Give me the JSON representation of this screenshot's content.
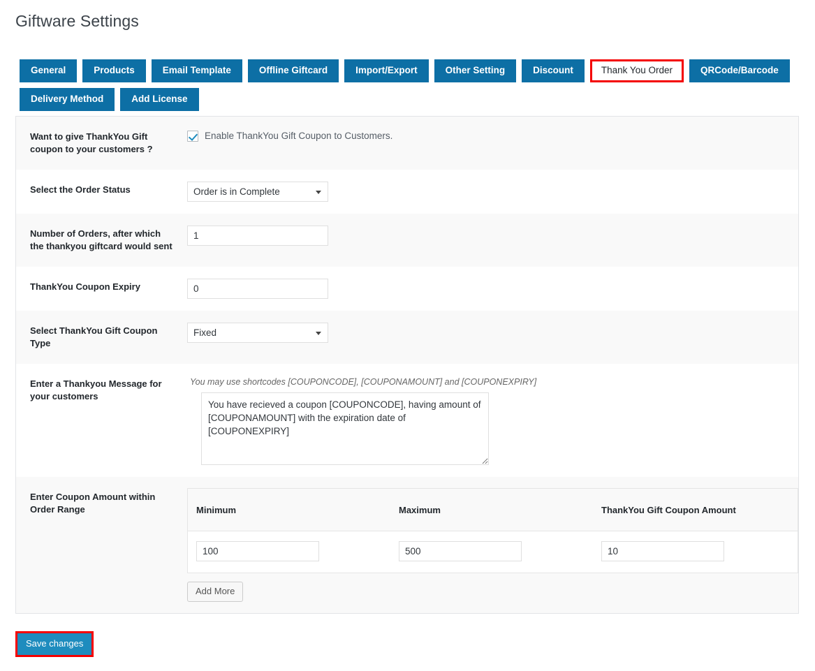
{
  "page": {
    "title": "Giftware Settings"
  },
  "tabs": {
    "row1": [
      {
        "label": "General",
        "active": false
      },
      {
        "label": "Products",
        "active": false
      },
      {
        "label": "Email Template",
        "active": false
      },
      {
        "label": "Offline Giftcard",
        "active": false
      },
      {
        "label": "Import/Export",
        "active": false
      },
      {
        "label": "Other Setting",
        "active": false
      },
      {
        "label": "Discount",
        "active": false
      },
      {
        "label": "Thank You Order",
        "active": true
      },
      {
        "label": "QRCode/Barcode",
        "active": false
      }
    ],
    "row2": [
      {
        "label": "Delivery Method",
        "active": false
      },
      {
        "label": "Add License",
        "active": false
      }
    ]
  },
  "form": {
    "enable": {
      "label": "Want to give ThankYou Gift coupon to your customers ?",
      "checkbox_label": "Enable ThankYou Gift Coupon to Customers.",
      "checked": true
    },
    "order_status": {
      "label": "Select the Order Status",
      "value": "Order is in Complete",
      "options": [
        "Order is in Complete"
      ]
    },
    "number_of_orders": {
      "label": "Number of Orders, after which the thankyou giftcard would sent",
      "value": "1"
    },
    "coupon_expiry": {
      "label": "ThankYou Coupon Expiry",
      "value": "0"
    },
    "coupon_type": {
      "label": "Select ThankYou Gift Coupon Type",
      "value": "Fixed",
      "options": [
        "Fixed"
      ]
    },
    "message": {
      "label": "Enter a Thankyou Message for your customers",
      "hint": "You may use shortcodes [COUPONCODE], [COUPONAMOUNT] and [COUPONEXPIRY]",
      "value": "You have recieved a coupon [COUPONCODE], having amount of [COUPONAMOUNT] with the expiration date of [COUPONEXPIRY]"
    },
    "range": {
      "label": "Enter Coupon Amount within Order Range",
      "columns": [
        "Minimum",
        "Maximum",
        "ThankYou Gift Coupon Amount"
      ],
      "rows": [
        {
          "minimum": "100",
          "maximum": "500",
          "amount": "10"
        }
      ],
      "add_more_label": "Add More"
    }
  },
  "footer": {
    "save_label": "Save changes"
  },
  "colors": {
    "tab_blue": "#0d6fa5",
    "highlight_red": "#f40000",
    "save_blue": "#1e8cbe",
    "row_alt": "#f9f9f9"
  }
}
